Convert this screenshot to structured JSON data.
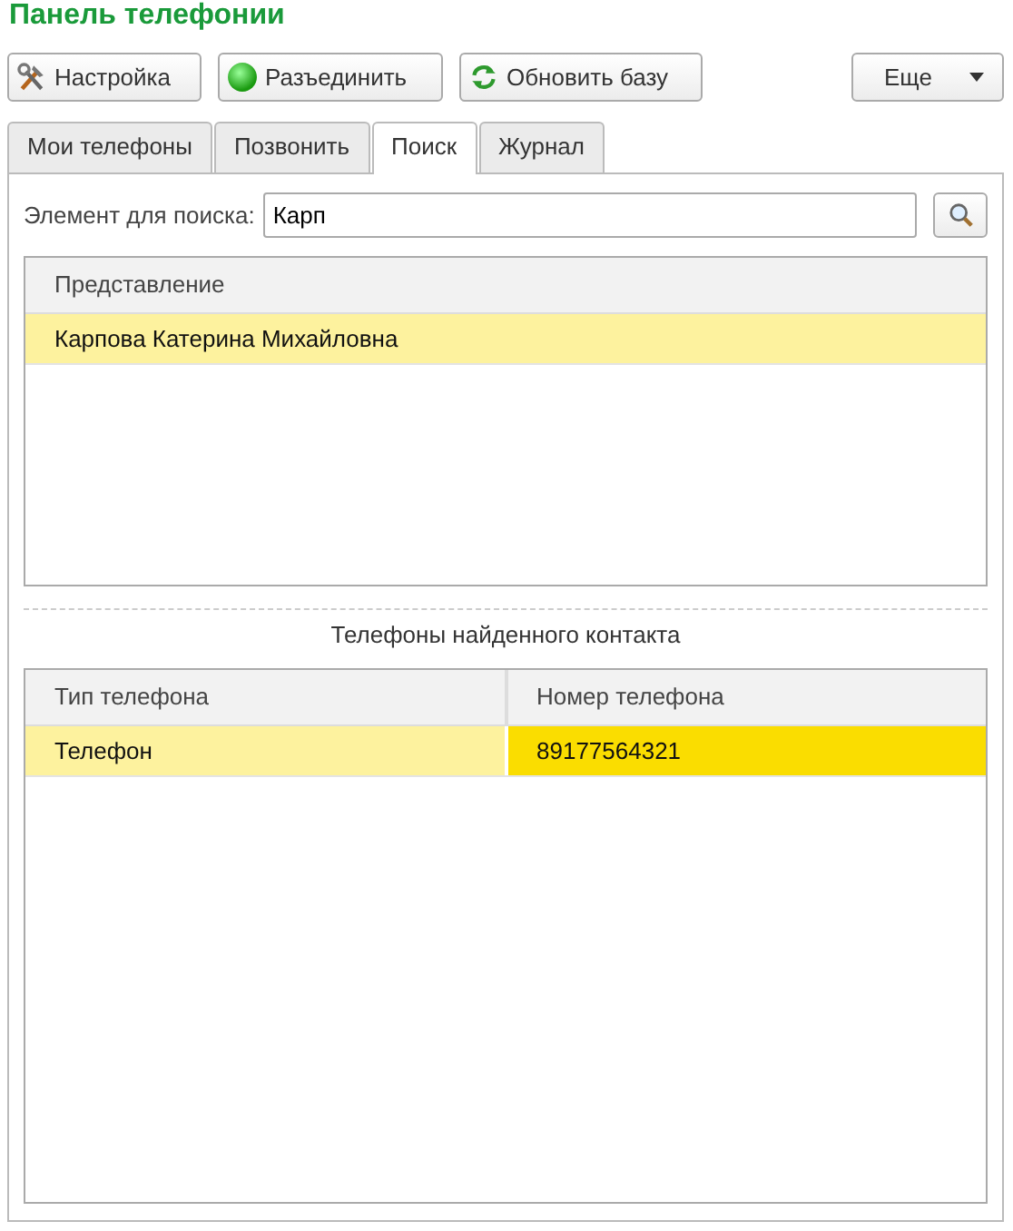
{
  "title": "Панель телефонии",
  "toolbar": [
    {
      "label": "Настройка",
      "kind": "tools"
    },
    {
      "label": "Разъединить",
      "kind": "status"
    },
    {
      "label": "Обновить базу",
      "kind": "refresh"
    }
  ],
  "more_button": {
    "label": "Еще"
  },
  "tabs": [
    {
      "label": "Мои телефоны",
      "selected": false
    },
    {
      "label": "Позвонить",
      "selected": false
    },
    {
      "label": "Поиск",
      "selected": true
    },
    {
      "label": "Журнал",
      "selected": false
    }
  ],
  "search": {
    "label": "Элемент для поиска:",
    "value": "Карп"
  },
  "results": {
    "columns": [
      "Представление"
    ],
    "rows": [
      {
        "cells": [
          {
            "text": "Карпова Катерина Михайловна",
            "focused": false
          }
        ],
        "selected": true
      }
    ]
  },
  "phones_caption": "Телефоны найденного контакта",
  "phones": {
    "columns": [
      "Тип телефона",
      "Номер телефона"
    ],
    "rows": [
      {
        "cells": [
          {
            "text": "Телефон",
            "focused": false
          },
          {
            "text": "89177564321",
            "focused": true
          }
        ],
        "selected": true
      }
    ]
  }
}
